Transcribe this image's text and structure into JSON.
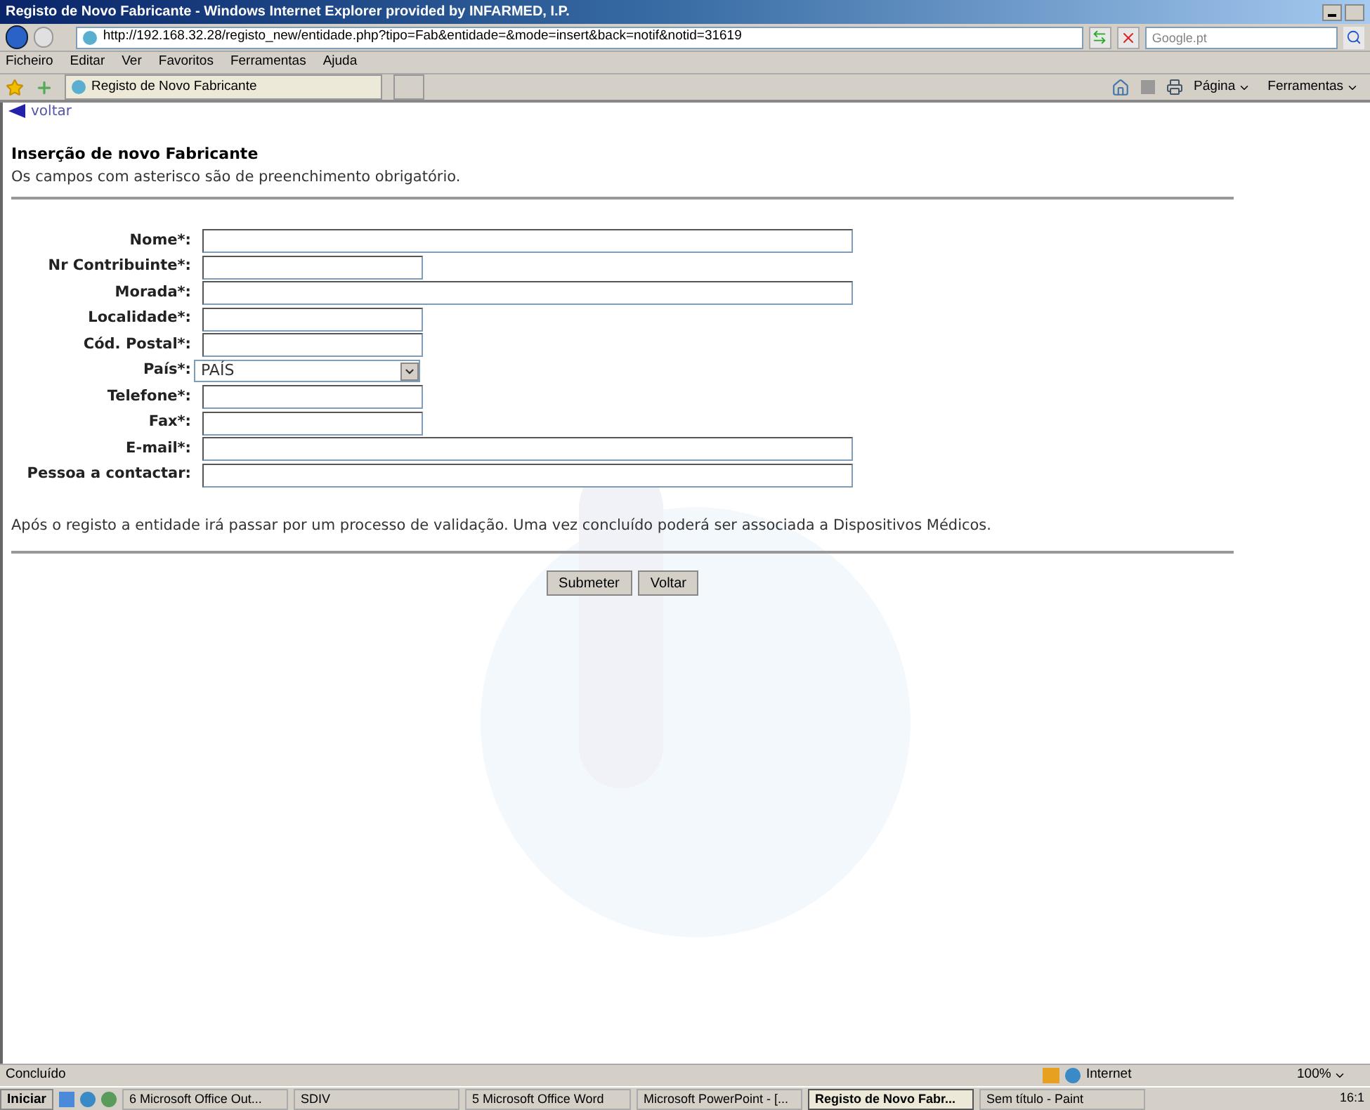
{
  "window": {
    "title": "Registo de Novo Fabricante - Windows Internet Explorer provided by INFARMED, I.P."
  },
  "address_bar": {
    "url": "http://192.168.32.28/registo_new/entidade.php?tipo=Fab&entidade=&mode=insert&back=notif&notid=31619",
    "search_placeholder": "Google.pt"
  },
  "menu_bar": [
    "Ficheiro",
    "Editar",
    "Ver",
    "Favoritos",
    "Ferramentas",
    "Ajuda"
  ],
  "tab": {
    "label": "Registo de Novo Fabricante"
  },
  "command_bar": [
    "Página",
    "Ferramentas"
  ],
  "page": {
    "back_link": "voltar",
    "heading": "Inserção de novo Fabricante",
    "subheading": "Os campos com asterisco são de preenchimento obrigatório.",
    "fields": [
      {
        "label": "Nome*:",
        "kind": "wide"
      },
      {
        "label": "Nr Contribuinte*:",
        "kind": "short"
      },
      {
        "label": "Morada*:",
        "kind": "wide"
      },
      {
        "label": "Localidade*:",
        "kind": "short"
      },
      {
        "label": "Cód. Postal*:",
        "kind": "short"
      },
      {
        "label": "País*:",
        "kind": "select",
        "value": "PAÍS"
      },
      {
        "label": "Telefone*:",
        "kind": "short"
      },
      {
        "label": "Fax*:",
        "kind": "short"
      },
      {
        "label": "E-mail*:",
        "kind": "wide"
      },
      {
        "label": "Pessoa a contactar:",
        "kind": "wide"
      }
    ],
    "note": "Após o registo a entidade irá passar por um processo de validação. Uma vez concluído poderá ser associada a Dispositivos Médicos.",
    "buttons": [
      "Submeter",
      "Voltar"
    ]
  },
  "status_bar": {
    "status": "Concluído",
    "zone": "Internet",
    "zoom": "100%"
  },
  "taskbar": {
    "start": "Iniciar",
    "tasks": [
      {
        "label": "6 Microsoft Office Out...",
        "selected": false
      },
      {
        "label": "SDIV",
        "selected": false
      },
      {
        "label": "5 Microsoft Office Word",
        "selected": false
      },
      {
        "label": "Microsoft PowerPoint - [...",
        "selected": false
      },
      {
        "label": "Registo de Novo Fabr...",
        "selected": true
      },
      {
        "label": "Sem título - Paint",
        "selected": false
      }
    ],
    "clock": "16:1"
  }
}
